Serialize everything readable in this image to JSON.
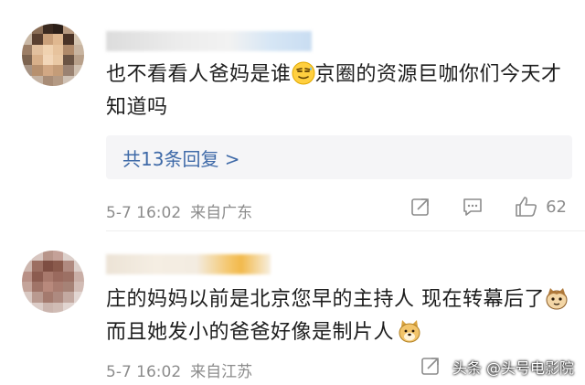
{
  "comments": [
    {
      "text_before": "也不看看人爸妈是谁",
      "emoji_1": "sweat-smile-emoji",
      "text_after": "京圈的资源巨咖你们今天才知道吗",
      "replies_label": "共13条回复 >",
      "time": "5-7 16:02",
      "location": "来自广东",
      "likes": "62"
    },
    {
      "text_before": "庄的妈妈以前是北京您早的主持人 现在转幕后了",
      "emoji_1": "cat-emoji",
      "text_after": "而且她发小的爸爸好像是制片人",
      "emoji_2": "doge-emoji",
      "time": "5-7 16:02",
      "location": "来自江苏"
    }
  ],
  "watermark": "头条 @头号电影院",
  "icons": [
    "share-icon",
    "comment-icon",
    "like-icon"
  ]
}
